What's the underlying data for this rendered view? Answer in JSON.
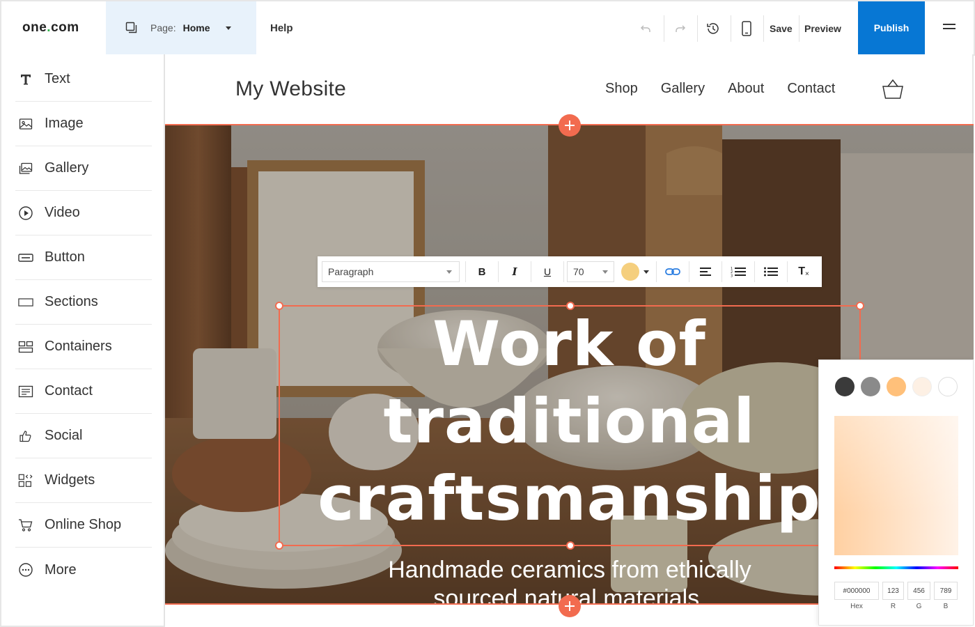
{
  "app": {
    "logo_prefix": "one",
    "logo_dot": ".",
    "logo_suffix": "com",
    "page_label": "Page:",
    "page_value": "Home",
    "help": "Help",
    "save": "Save",
    "preview": "Preview",
    "publish": "Publish",
    "accent_color": "#0777d4",
    "selection_color": "#f26b4f"
  },
  "sidebar": {
    "items": [
      {
        "label": "Text",
        "icon": "text-icon"
      },
      {
        "label": "Image",
        "icon": "image-icon"
      },
      {
        "label": "Gallery",
        "icon": "gallery-icon"
      },
      {
        "label": "Video",
        "icon": "video-icon"
      },
      {
        "label": "Button",
        "icon": "button-icon"
      },
      {
        "label": "Sections",
        "icon": "sections-icon"
      },
      {
        "label": "Containers",
        "icon": "containers-icon"
      },
      {
        "label": "Contact",
        "icon": "contact-icon"
      },
      {
        "label": "Social",
        "icon": "thumbs-up-icon"
      },
      {
        "label": "Widgets",
        "icon": "widgets-icon"
      },
      {
        "label": "Online Shop",
        "icon": "cart-icon"
      },
      {
        "label": "More",
        "icon": "more-icon"
      }
    ]
  },
  "site": {
    "title": "My Website",
    "nav": [
      "Shop",
      "Gallery",
      "About",
      "Contact"
    ],
    "headline_lines": [
      "Work of",
      "traditional",
      "craftsmanship"
    ],
    "subtitle_lines": [
      "Handmade ceramics from ethically",
      "sourced natural materials."
    ]
  },
  "format_toolbar": {
    "paragraph": "Paragraph",
    "bold": "B",
    "italic": "I",
    "underline": "U",
    "font_size": "70",
    "clear_format": "T",
    "text_color": "#f5cf7e"
  },
  "color_picker": {
    "swatches": [
      "#3a3a3a",
      "#8a8a8a",
      "#ffc07a",
      "#fdf0e4",
      "#ffffff"
    ],
    "hex_value": "#000000",
    "r_value": "123",
    "g_value": "456",
    "b_value": "789",
    "hex_label": "Hex",
    "r_label": "R",
    "g_label": "G",
    "b_label": "B"
  }
}
